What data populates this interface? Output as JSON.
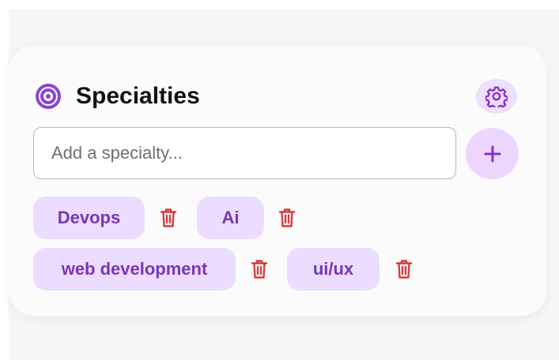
{
  "panel": {
    "title": "Specialties"
  },
  "input": {
    "placeholder": "Add a specialty..."
  },
  "actions": {
    "add_icon": "plus-icon",
    "settings_icon": "gear-icon",
    "delete_icon": "trash-icon"
  },
  "specialties": [
    {
      "label": "Devops"
    },
    {
      "label": "Ai"
    },
    {
      "label": "web development"
    },
    {
      "label": "ui/ux"
    }
  ],
  "colors": {
    "accent": "#7a35b4",
    "chip_background": "#ecdcff",
    "delete": "#d63d3d",
    "card_background": "#fbfbfc"
  }
}
